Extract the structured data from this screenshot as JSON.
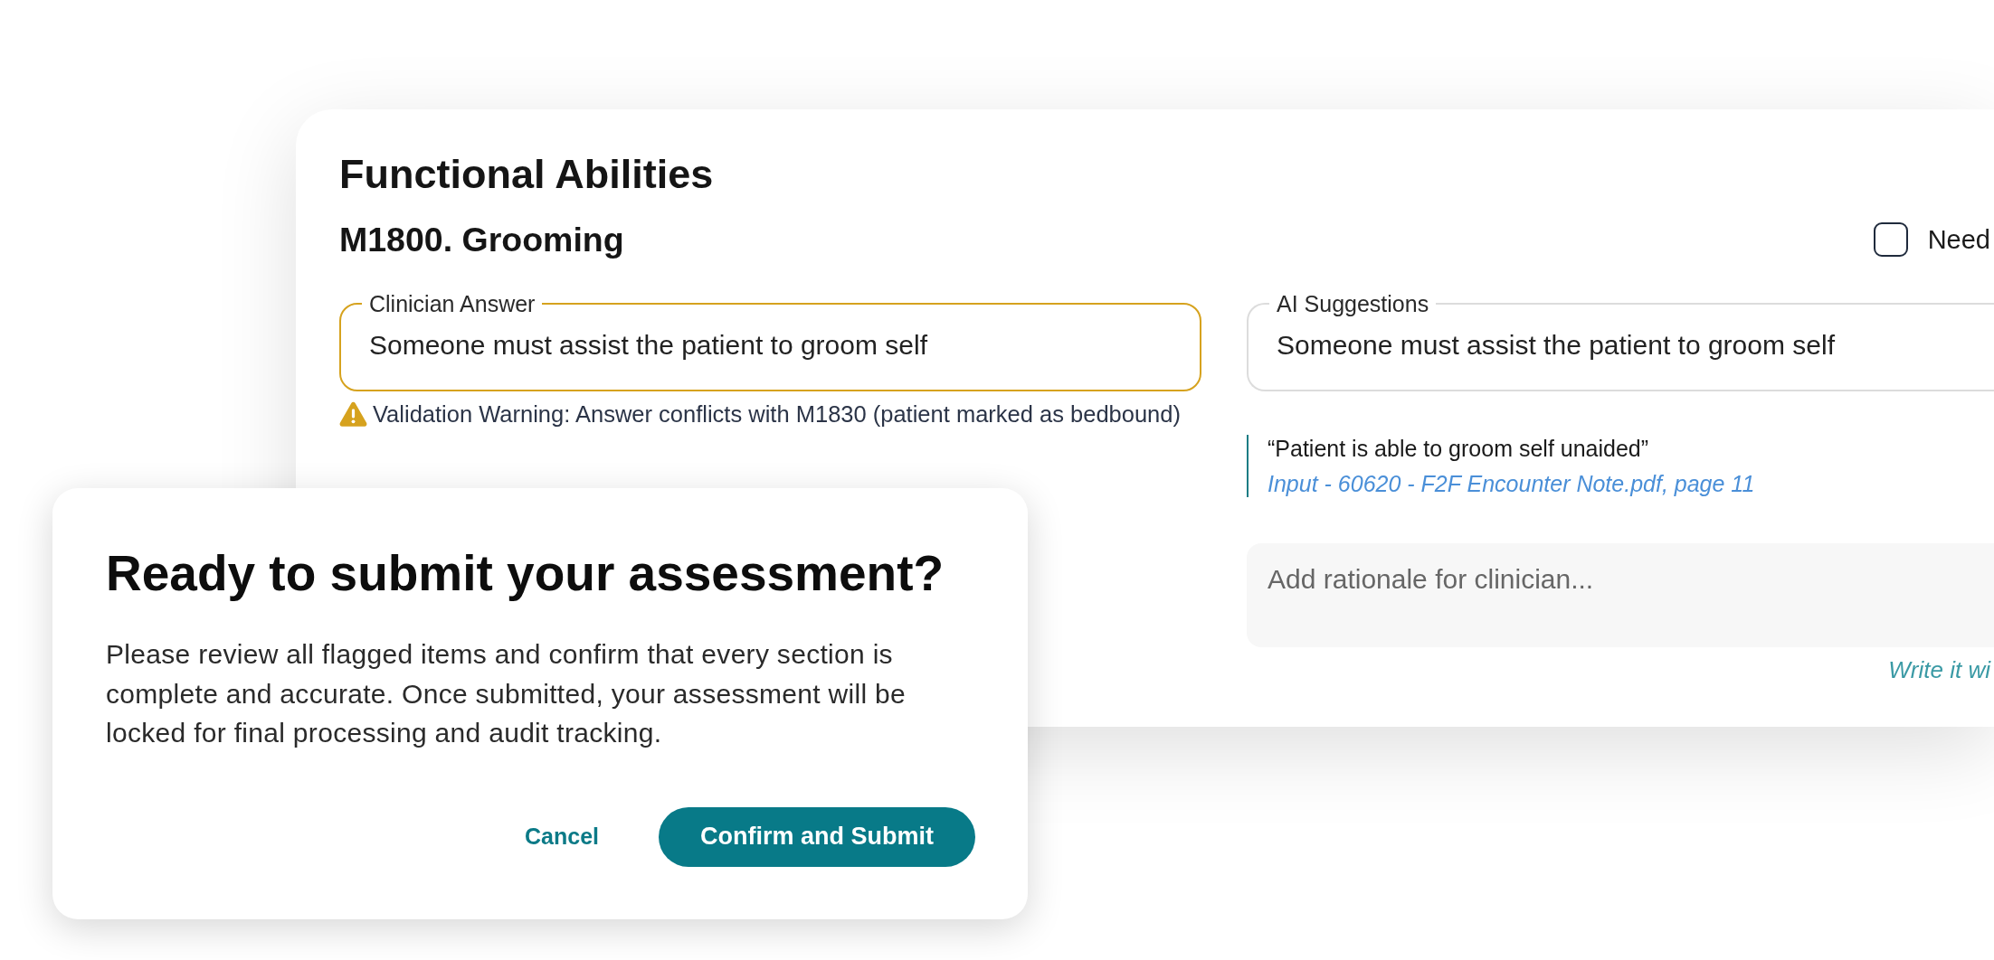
{
  "section": {
    "title": "Functional Abilities"
  },
  "question": {
    "title": "M1800. Grooming",
    "flag": {
      "label": "Need",
      "checked": false
    }
  },
  "clinician_answer": {
    "label": "Clinician Answer",
    "value": "Someone must assist the patient to groom self",
    "has_warning": true,
    "warning": "Validation Warning: Answer conflicts with M1830 (patient marked as bedbound)"
  },
  "ai_suggestions": {
    "label": "AI Suggestions",
    "value": "Someone must assist the patient to groom self",
    "evidence": {
      "quote": "“Patient is able to groom self unaided”",
      "source": "Input - 60620 - F2F Encounter Note.pdf, page 11"
    },
    "rationale": {
      "placeholder": "Add rationale for clinician..."
    },
    "assist_link": "Write it wi"
  },
  "dialog": {
    "title": "Ready to submit your assessment?",
    "body": "Please review all flagged items and confirm that every section is complete and accurate. Once submitted, your assessment will be locked for final processing and audit tracking.",
    "buttons": [
      {
        "label": "Cancel",
        "kind": "text"
      },
      {
        "label": "Confirm and Submit",
        "kind": "primary"
      }
    ]
  }
}
